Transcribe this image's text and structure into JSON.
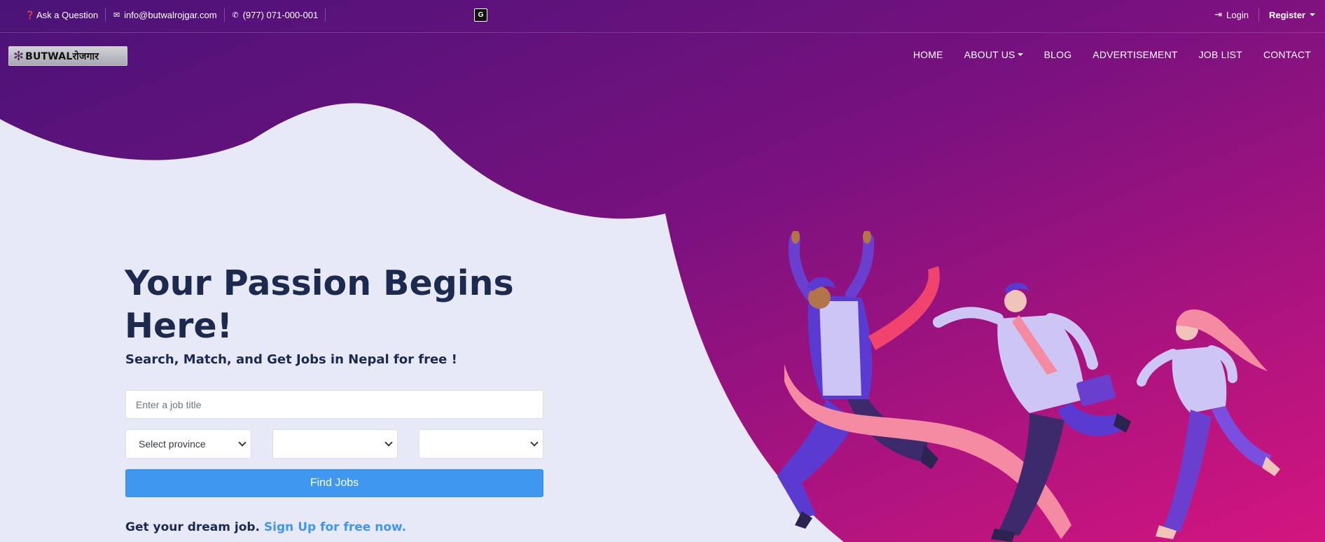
{
  "topbar": {
    "ask_label": "Ask a Question",
    "email": "info@butwalrojgar.com",
    "phone": "(977) 071-000-001",
    "login_label": "Login",
    "register_label": "Register"
  },
  "logo": {
    "text": "BUTWALरोजगार"
  },
  "nav": {
    "items": [
      "HOME",
      "ABOUT US",
      "BLOG",
      "ADVERTISEMENT",
      "JOB LIST",
      "CONTACT"
    ]
  },
  "hero": {
    "title": "Your Passion Begins Here!",
    "subtitle": "Search, Match, and Get Jobs in Nepal for free !",
    "job_placeholder": "Enter a job title",
    "province_select": "Select province",
    "district_select": "",
    "city_select": "",
    "find_button": "Find Jobs",
    "dream_text": "Get your dream job.",
    "signup_link": "Sign Up for free now."
  },
  "colors": {
    "purple_dark": "#4a1378",
    "magenta": "#d4177f",
    "page_bg": "#e8e9f6",
    "heading": "#1b2a4e",
    "accent_blue": "#3f97f0"
  }
}
